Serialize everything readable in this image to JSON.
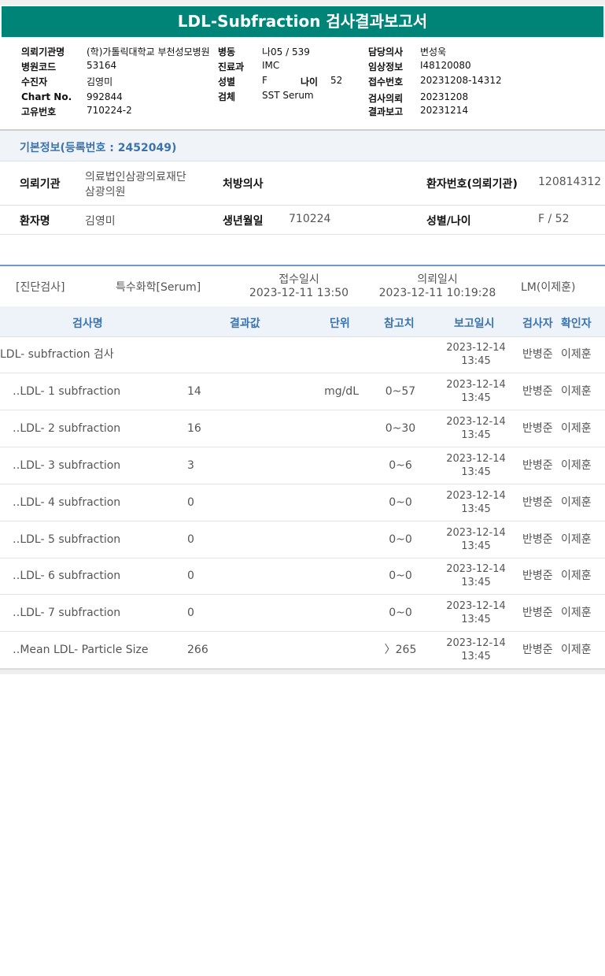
{
  "report": {
    "title": "LDL-Subfraction 검사결과보고서"
  },
  "header": {
    "hospital_label": "의뢰기관명",
    "hospital": "(학)가톨릭대학교 부천성모병원",
    "ward_label": "병동",
    "ward": "나05 / 539",
    "doctor_label": "담당의사",
    "doctor": "변성욱",
    "code_label": "병원코드",
    "code": "53164",
    "dept_label": "진료과",
    "dept": "IMC",
    "clinical_label": "임상정보",
    "clinical": "I48120080",
    "patient_label": "수진자",
    "patient": "김영미",
    "sex_label": "성별",
    "sex": "F",
    "age_label": "나이",
    "age": "52",
    "accept_label": "접수번호",
    "accept": "20231208-14312",
    "chart_label": "Chart No.",
    "chart": "992844",
    "specimen_label": "검체",
    "specimen": "SST Serum",
    "request_label": "검사의뢰",
    "request": "20231208",
    "unique_label": "고유번호",
    "unique": "710224-2",
    "result_label": "결과보고",
    "result": "20231214"
  },
  "basic": {
    "title": "기본정보(등록번호 : 2452049)",
    "institution_label": "의뢰기관",
    "institution_line1": "의료법인삼광의료재단",
    "institution_line2": "삼광의원",
    "prescriber_label": "처방의사",
    "prescriber": "",
    "patient_no_label": "환자번호(의뢰기관)",
    "patient_no": "120814312",
    "name_label": "환자명",
    "name": "김영미",
    "birth_label": "생년월일",
    "birth": "710224",
    "sexage_label": "성별/나이",
    "sexage": "F / 52"
  },
  "meta": {
    "category": "[진단검사]",
    "subcategory": "특수화학[Serum]",
    "received_label": "접수일시",
    "received": "2023-12-11 13:50",
    "requested_label": "의뢰일시",
    "requested": "2023-12-11 10:19:28",
    "lab": "LM(이제훈)"
  },
  "table": {
    "headers": {
      "name": "검사명",
      "value": "결과값",
      "unit": "단위",
      "ref": "참고치",
      "date": "보고일시",
      "tester": "검사자",
      "confirm": "확인자"
    },
    "rows": [
      {
        "name": "LDL- subfraction 검사",
        "value": "",
        "unit": "",
        "ref": "",
        "date1": "2023-12-14",
        "date2": "13:45",
        "tester": "반병준",
        "confirm": "이제훈"
      },
      {
        "name": "‥LDL- 1 subfraction",
        "value": "14",
        "unit": "mg/dL",
        "ref": "0~57",
        "date1": "2023-12-14",
        "date2": "13:45",
        "tester": "반병준",
        "confirm": "이제훈"
      },
      {
        "name": "‥LDL- 2 subfraction",
        "value": "16",
        "unit": "",
        "ref": "0~30",
        "date1": "2023-12-14",
        "date2": "13:45",
        "tester": "반병준",
        "confirm": "이제훈"
      },
      {
        "name": "‥LDL- 3 subfraction",
        "value": "3",
        "unit": "",
        "ref": "0~6",
        "date1": "2023-12-14",
        "date2": "13:45",
        "tester": "반병준",
        "confirm": "이제훈"
      },
      {
        "name": "‥LDL- 4 subfraction",
        "value": "0",
        "unit": "",
        "ref": "0~0",
        "date1": "2023-12-14",
        "date2": "13:45",
        "tester": "반병준",
        "confirm": "이제훈"
      },
      {
        "name": "‥LDL- 5 subfraction",
        "value": "0",
        "unit": "",
        "ref": "0~0",
        "date1": "2023-12-14",
        "date2": "13:45",
        "tester": "반병준",
        "confirm": "이제훈"
      },
      {
        "name": "‥LDL- 6 subfraction",
        "value": "0",
        "unit": "",
        "ref": "0~0",
        "date1": "2023-12-14",
        "date2": "13:45",
        "tester": "반병준",
        "confirm": "이제훈"
      },
      {
        "name": "‥LDL- 7 subfraction",
        "value": "0",
        "unit": "",
        "ref": "0~0",
        "date1": "2023-12-14",
        "date2": "13:45",
        "tester": "반병준",
        "confirm": "이제훈"
      },
      {
        "name": "‥Mean LDL- Particle Size",
        "value": "266",
        "unit": "",
        "ref": "〉265",
        "date1": "2023-12-14",
        "date2": "13:45",
        "tester": "반병준",
        "confirm": "이제훈"
      }
    ]
  }
}
